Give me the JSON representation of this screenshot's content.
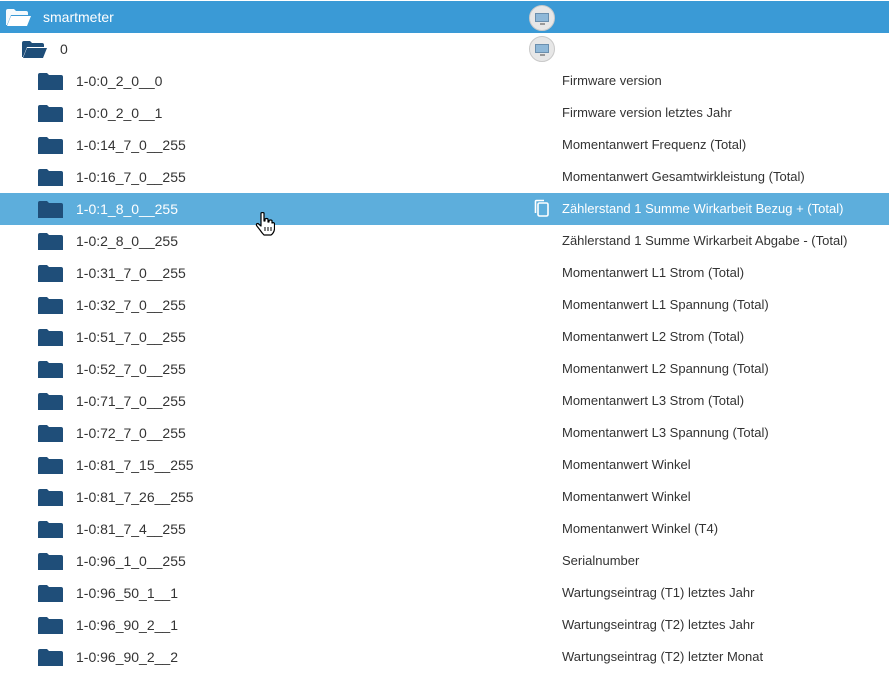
{
  "root": {
    "label": "smartmeter"
  },
  "channel": {
    "label": "0"
  },
  "items": [
    {
      "id": "1-0:0_2_0__0",
      "desc": "Firmware version"
    },
    {
      "id": "1-0:0_2_0__1",
      "desc": "Firmware version letztes Jahr"
    },
    {
      "id": "1-0:14_7_0__255",
      "desc": "Momentanwert Frequenz (Total)"
    },
    {
      "id": "1-0:16_7_0__255",
      "desc": "Momentanwert Gesamtwirkleistung (Total)"
    },
    {
      "id": "1-0:1_8_0__255",
      "desc": "Zählerstand 1 Summe Wirkarbeit Bezug + (Total)"
    },
    {
      "id": "1-0:2_8_0__255",
      "desc": "Zählerstand 1 Summe Wirkarbeit Abgabe - (Total)"
    },
    {
      "id": "1-0:31_7_0__255",
      "desc": "Momentanwert L1 Strom (Total)"
    },
    {
      "id": "1-0:32_7_0__255",
      "desc": "Momentanwert L1 Spannung (Total)"
    },
    {
      "id": "1-0:51_7_0__255",
      "desc": "Momentanwert L2 Strom (Total)"
    },
    {
      "id": "1-0:52_7_0__255",
      "desc": "Momentanwert L2 Spannung (Total)"
    },
    {
      "id": "1-0:71_7_0__255",
      "desc": "Momentanwert L3 Strom (Total)"
    },
    {
      "id": "1-0:72_7_0__255",
      "desc": "Momentanwert L3 Spannung (Total)"
    },
    {
      "id": "1-0:81_7_15__255",
      "desc": "Momentanwert Winkel"
    },
    {
      "id": "1-0:81_7_26__255",
      "desc": "Momentanwert Winkel"
    },
    {
      "id": "1-0:81_7_4__255",
      "desc": "Momentanwert Winkel (T4)"
    },
    {
      "id": "1-0:96_1_0__255",
      "desc": "Serialnumber"
    },
    {
      "id": "1-0:96_50_1__1",
      "desc": "Wartungseintrag (T1) letztes Jahr"
    },
    {
      "id": "1-0:96_90_2__1",
      "desc": "Wartungseintrag (T2) letztes Jahr"
    },
    {
      "id": "1-0:96_90_2__2",
      "desc": "Wartungseintrag (T2) letzter Monat"
    }
  ],
  "selected_index": 4,
  "colors": {
    "root_bg": "#3a9ad6",
    "selected_bg": "#5daedc",
    "folder": "#1f4e79"
  },
  "icons": {
    "root": "folder-open-icon",
    "channel": "folder-open-icon",
    "item": "folder-icon",
    "adapter": "smartmeter-adapter-icon",
    "copy": "copy-icon",
    "cursor": "hand-pointer-cursor"
  }
}
